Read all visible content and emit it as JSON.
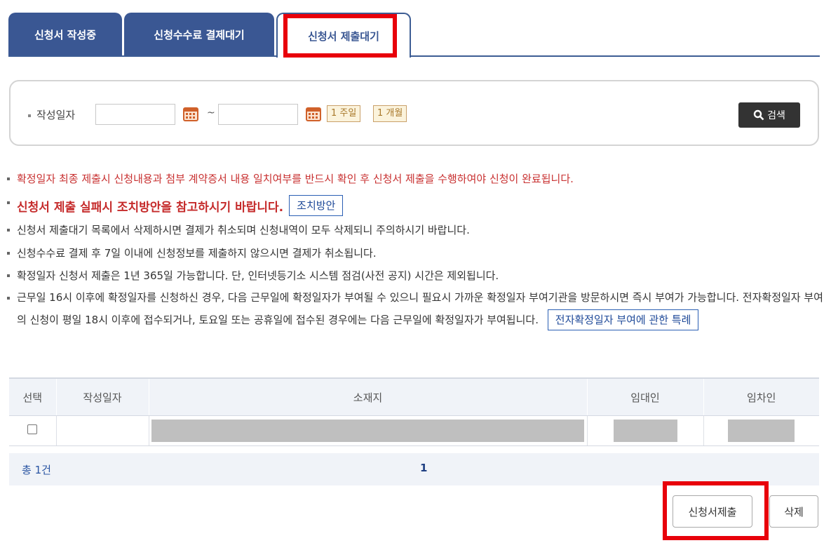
{
  "tabs": [
    {
      "label": "신청서 작성중"
    },
    {
      "label": "신청수수료 결제대기"
    },
    {
      "label": "신청서 제출대기"
    }
  ],
  "search": {
    "label": "작성일자",
    "range_sep": "~",
    "period_1week": "1 주일",
    "period_1month": "1 개월",
    "button_label": "검색",
    "from_value": "",
    "to_value": ""
  },
  "notices": {
    "n1": "확정일자 최종 제출시 신청내용과 첨부 계약증서 내용 일치여부를 반드시 확인 후 신청서 제출을 수행하여야 신청이 완료됩니다.",
    "n2": "신청서 제출 실패시 조치방안을 참고하시기 바랍니다.",
    "n2_button": "조치방안",
    "n3": "신청서 제출대기 목록에서 삭제하시면 결제가 취소되며 신청내역이 모두 삭제되니 주의하시기 바랍니다.",
    "n4": "신청수수료 결제 후 7일 이내에 신청정보를 제출하지 않으시면 결제가 취소됩니다.",
    "n5": "확정일자 신청서 제출은 1년 365일 가능합니다. 단, 인터넷등기소 시스템 점검(사전 공지) 시간은 제외됩니다.",
    "n6": "근무일 16시 이후에 확정일자를 신청하신 경우, 다음 근무일에 확정일자가 부여될 수 있으니 필요시 가까운 확정일자 부여기관을 방문하시면 즉시 부여가 가능합니다. 전자확정일자 부여의 신청이 평일 18시 이후에 접수되거나, 토요일 또는 공휴일에 접수된 경우에는 다음 근무일에 확정일자가 부여됩니다.",
    "n6_button": "전자확정일자 부여에 관한 특례"
  },
  "table": {
    "headers": [
      "선택",
      "작성일자",
      "소재지",
      "임대인",
      "임차인"
    ]
  },
  "pager": {
    "total": "총 1건",
    "current_page": "1"
  },
  "actions": {
    "submit_label": "신청서제출",
    "delete_label": "삭제"
  },
  "colors": {
    "tab_blue": "#3a5793",
    "highlight_red": "#e8000b",
    "notice_red": "#c83030"
  }
}
